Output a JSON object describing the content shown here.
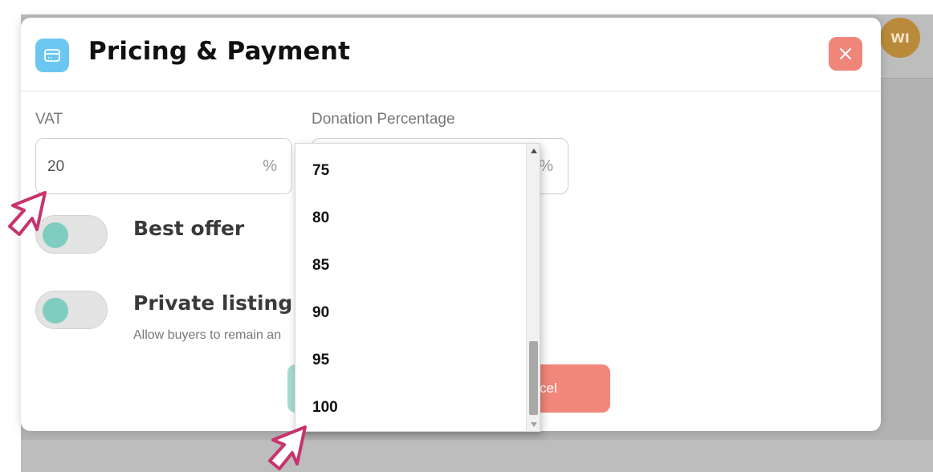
{
  "background": {
    "avatar_initials": "WI"
  },
  "modal": {
    "title": "Pricing & Payment",
    "vat": {
      "label": "VAT",
      "value": "20",
      "unit": "%"
    },
    "donation": {
      "label": "Donation Percentage",
      "unit": "%"
    },
    "toggles": [
      {
        "label": "Best offer"
      },
      {
        "label": "Private listing",
        "helper": "Allow buyers to remain an"
      }
    ],
    "cancel_label": "cel"
  },
  "dropdown": {
    "options": [
      "75",
      "80",
      "85",
      "90",
      "95",
      "100"
    ]
  },
  "colors": {
    "title_icon": "#6cc7f0",
    "close": "#f0857a",
    "toggle_knob": "#7fccc0",
    "save_button": "#a7dcd2",
    "cancel_button": "#f2877b",
    "cursor": "#c8336e"
  }
}
